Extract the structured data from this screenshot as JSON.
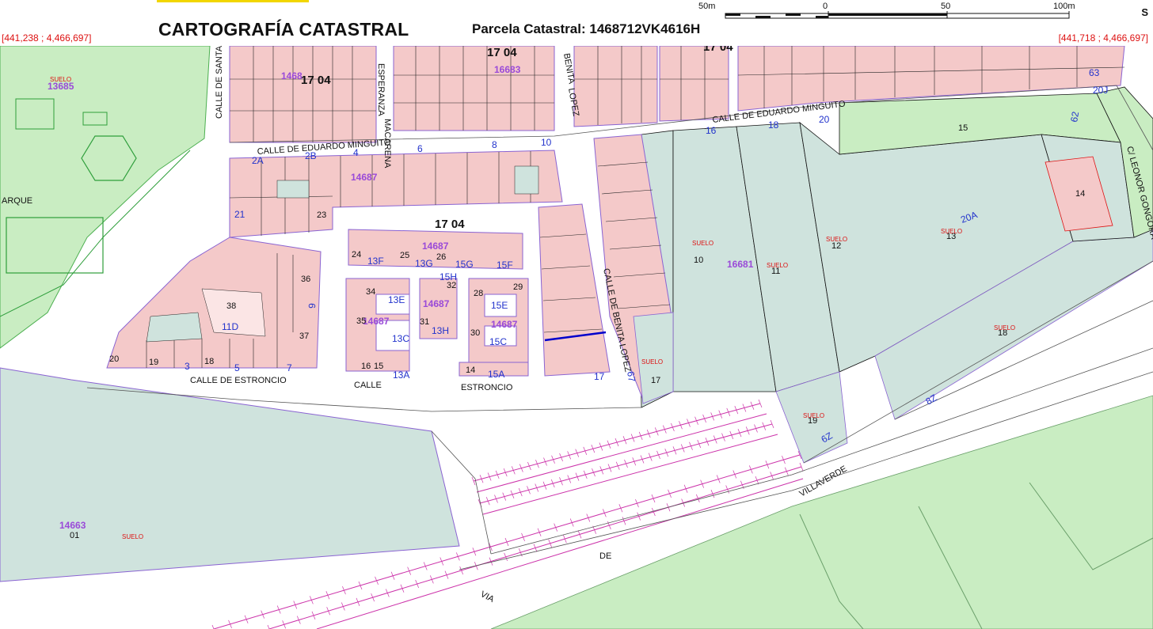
{
  "header": {
    "title": "CARTOGRAFÍA CATASTRAL",
    "parcel": "Parcela Catastral: 1468712VK4616H",
    "coord_left": "[441,238 ; 4,466,697]",
    "coord_right": "[441,718 ; 4,466,697]"
  },
  "scale": {
    "labels": [
      "50m",
      "0",
      "50",
      "100m"
    ],
    "north": "S"
  },
  "colors": {
    "building": "#f4c9c9",
    "plot": "#cfe3dd",
    "park": "#c9edc2",
    "road": "#ffffff",
    "rail": "#cc33aa",
    "parcel_line": "#8a63d2",
    "label_red": "#dd1111",
    "label_blue": "#2233cc"
  },
  "streets": {
    "minguito_w": "CALLE DE EDUARDO MINGUITO",
    "minguito_e": "CALLE DE EDUARDO MINGUITO",
    "santa": "CALLE DE SANTA",
    "esperanza": "ESPERANZA",
    "macarena": "MACARENA",
    "benita_top": "BENITA",
    "lopez_top": "LOPEZ",
    "benita": "CALLE DE BENITA LOPEZ",
    "estroncio1": "CALLE DE ESTRONCIO",
    "calle": "CALLE",
    "estroncio2": "ESTRONCIO",
    "villaverde": "VILLAVERDE",
    "de": "DE",
    "via": "VIA",
    "leonor": "C/ LEONOR GONGORA",
    "parque": "ARQUE"
  },
  "blocks": {
    "b1": "17 04",
    "b2": "17 04",
    "b3": "17 04",
    "b4": "17 04"
  },
  "refs": {
    "r13685": "13685",
    "r1468": "1468",
    "r14687a": "14687",
    "r14687b": "14687",
    "r14687c": "14687",
    "r14687d": "14687",
    "r14687e": "14687",
    "r16681": "16681",
    "r14663": "14663",
    "r16683": "16683"
  },
  "plots": {
    "p10": "10",
    "p11": "11",
    "p12": "12",
    "p13": "13",
    "p14": "14",
    "p15": "15",
    "p16": "16",
    "p17": "17",
    "p18": "18",
    "p19": "19",
    "p01": "01",
    "p38": "38",
    "p20a": "20A",
    "p8z": "8Z",
    "p6z": "6Z",
    "p11d": "11D",
    "p21": "21",
    "p23": "23",
    "p36": "36",
    "p37": "37",
    "p13f": "13F",
    "p13g": "13G",
    "p15g": "15G",
    "p15f": "15F",
    "p13e": "13E",
    "p15e": "15E",
    "p13c": "13C",
    "p13h": "13H",
    "p15c": "15C",
    "p13a": "13A",
    "p15a": "15A",
    "p15h": "15H",
    "p24": "24",
    "p25": "25",
    "p26": "26",
    "p32": "32",
    "p28": "28",
    "p29": "29",
    "p31": "31",
    "p30": "30",
    "p35": "35",
    "p34": "34",
    "p16b": "16",
    "p15b": "15",
    "p14b": "14",
    "p2a": "2A",
    "p2b": "2B",
    "p6": "6",
    "p8": "8",
    "p10b": "10",
    "p4": "4",
    "p16t": "16",
    "p18t": "18",
    "p20t": "20",
    "p20j": "20J",
    "p62": "62",
    "p63": "63",
    "p67": "67",
    "p17t": "17",
    "p19b": "19",
    "p20b": "20",
    "p18b": "18",
    "p3": "3",
    "p5": "5",
    "p7": "7",
    "p9": "9"
  },
  "suelo": "SUELO"
}
